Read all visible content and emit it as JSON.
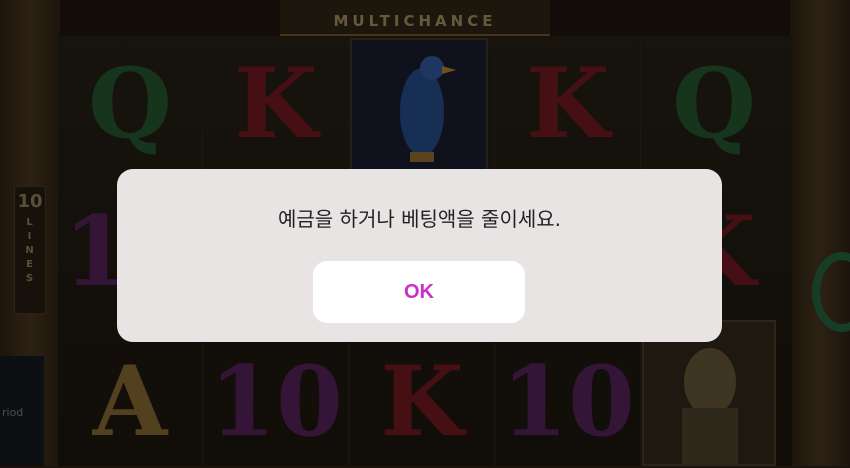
{
  "game": {
    "logo_text": "MULTICHANCE",
    "lines_count": "10",
    "lines_word": "LINES",
    "side_panel_text": "riod",
    "reel_symbols": [
      [
        "Q",
        "10",
        "A"
      ],
      [
        "K",
        "",
        "10"
      ],
      [
        "",
        "",
        "K"
      ],
      [
        "K",
        "",
        "10"
      ],
      [
        "Q",
        "K",
        ""
      ]
    ],
    "symbol_colors": {
      "Q": "#2f6b3a",
      "K": "#8a1f28",
      "10": "#6b2a6e",
      "A": "#a4813e"
    }
  },
  "dialog": {
    "message": "예금을 하거나 베팅액을 줄이세요.",
    "ok_label": "OK",
    "ok_color": "#cc2fc4"
  }
}
